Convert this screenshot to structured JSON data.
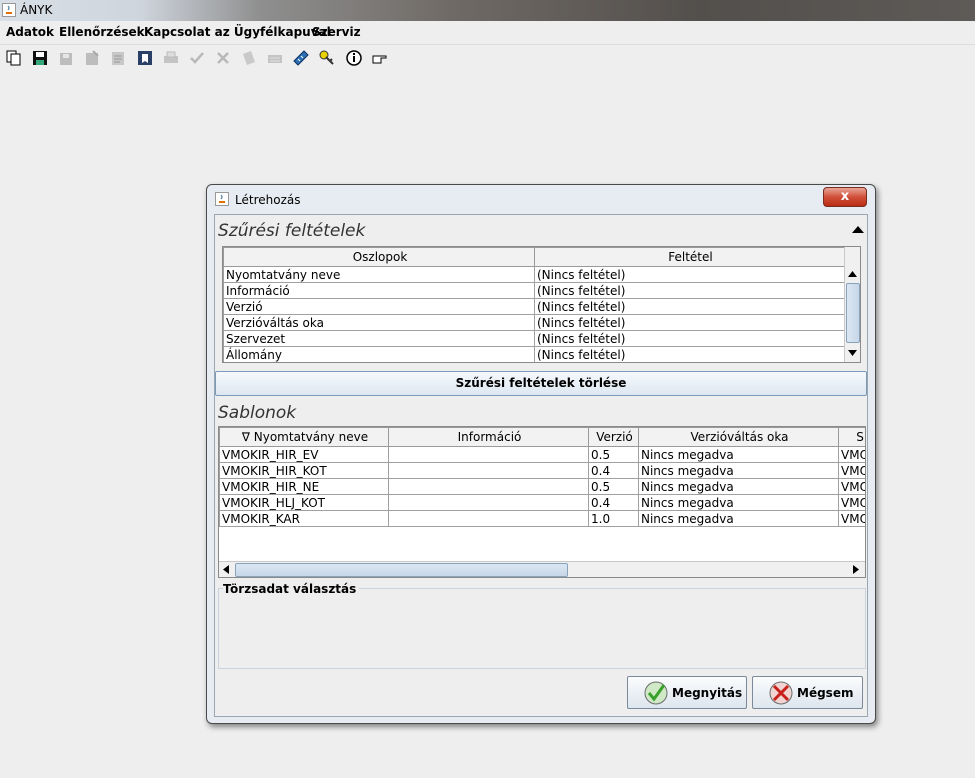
{
  "window": {
    "title": "ÁNYK"
  },
  "menu": [
    "Adatok",
    "Ellenőrzések",
    "Kapcsolat az Ügyfélkapuval",
    "Szerviz"
  ],
  "toolbar": {
    "icons": [
      "copy-icon",
      "save-icon",
      "save-disabled-icon",
      "save-as-disabled-icon",
      "print-preview-disabled-icon",
      "info-book-icon",
      "print-disabled-icon",
      "check-disabled-icon",
      "delete-disabled-icon",
      "document-disabled-icon",
      "keyboard-disabled-icon",
      "calculator-icon",
      "key-icon",
      "info-icon",
      "pointing-hand-icon"
    ]
  },
  "dialog": {
    "title": "Létrehozás",
    "close_label": "x",
    "filter": {
      "title": "Szűrési feltételek",
      "headers": [
        "Oszlopok",
        "Feltétel"
      ],
      "rows": [
        [
          "Nyomtatvány neve",
          "(Nincs feltétel)"
        ],
        [
          "Információ",
          "(Nincs feltétel)"
        ],
        [
          "Verzió",
          "(Nincs feltétel)"
        ],
        [
          "Verzióváltás oka",
          "(Nincs feltétel)"
        ],
        [
          "Szervezet",
          "(Nincs feltétel)"
        ],
        [
          "Állomány",
          "(Nincs feltétel)"
        ]
      ],
      "clear_button": "Szűrési feltételek törlése"
    },
    "templates": {
      "title": "Sablonok",
      "headers": [
        "∇ Nyomtatvány neve",
        "Információ",
        "Verzió",
        "Verzióváltás oka",
        "S"
      ],
      "rows": [
        [
          "VMOKIR_HIR_EV",
          "",
          "0.5",
          "Nincs megadva",
          "VMO"
        ],
        [
          "VMOKIR_HIR_KOT",
          "",
          "0.4",
          "Nincs megadva",
          "VMO"
        ],
        [
          "VMOKIR_HIR_NE",
          "",
          "0.5",
          "Nincs megadva",
          "VMO"
        ],
        [
          "VMOKIR_HLJ_KOT",
          "",
          "0.4",
          "Nincs megadva",
          "VMO"
        ],
        [
          "VMOKIR_KAR",
          "",
          "1.0",
          "Nincs megadva",
          "VMO"
        ]
      ]
    },
    "master_data": {
      "title": "Törzsadat választás"
    },
    "buttons": {
      "open": "Megnyitás",
      "cancel": "Mégsem"
    }
  },
  "colors": {
    "button_border": "#7b8a9a",
    "close_red": "#d0503a",
    "check_green": "#3aa02c",
    "cancel_red": "#c8201a"
  }
}
